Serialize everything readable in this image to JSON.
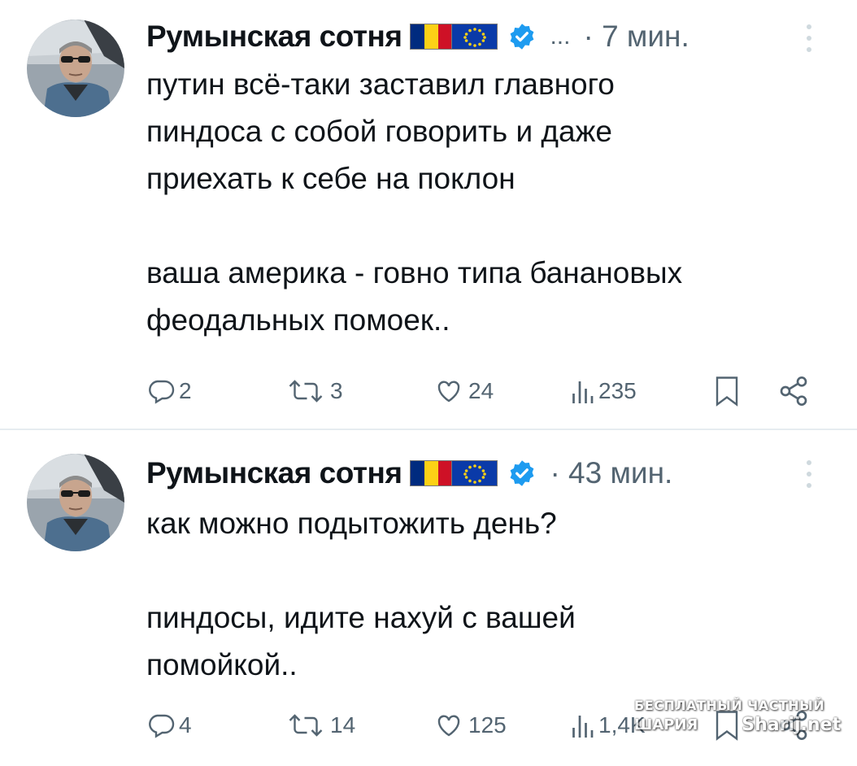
{
  "tweets": [
    {
      "author": "Румынская сотня",
      "flags": [
        "romania-flag",
        "eu-flag"
      ],
      "verified": true,
      "ellipsis": "...",
      "time": "· 7 мин.",
      "lines": [
        "путин всё-таки заставил главного",
        "пиндоса с собой говорить и даже",
        "приехать к себе на поклон",
        "",
        "ваша америка - говно типа банановых",
        "феодальных помоек.."
      ],
      "replies": "2",
      "retweets": "3",
      "likes": "24",
      "views": "235"
    },
    {
      "author": "Румынская сотня",
      "flags": [
        "romania-flag",
        "eu-flag"
      ],
      "verified": true,
      "time": "· 43 мин.",
      "lines": [
        "как можно подытожить день?",
        "",
        "пиндосы, идите нахуй с вашей",
        "помойкой.."
      ],
      "replies": "4",
      "retweets": "14",
      "likes": "125",
      "views": "1,4K"
    }
  ],
  "watermark": {
    "line1": "БЕСПЛАТНЫЙ ЧАСТНЫЙ",
    "line2": "ШАРИЯ",
    "line3": "Sharij.net"
  },
  "colors": {
    "text": "#0f1419",
    "secondary": "#536471",
    "verified": "#1d9bf0",
    "romania_blue": "#002b7f",
    "romania_yellow": "#fcd116",
    "romania_red": "#ce1126",
    "eu_blue": "#0a3aa8"
  }
}
